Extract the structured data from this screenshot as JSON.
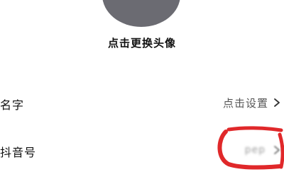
{
  "avatar": {
    "caption": "点击更换头像"
  },
  "rows": [
    {
      "label": "名字",
      "value": "点击设置"
    },
    {
      "label": "抖音号",
      "value": "pep"
    }
  ],
  "annotation": {
    "color": "#e0282a"
  },
  "icons": {
    "chevron": "chevron-right-icon"
  }
}
